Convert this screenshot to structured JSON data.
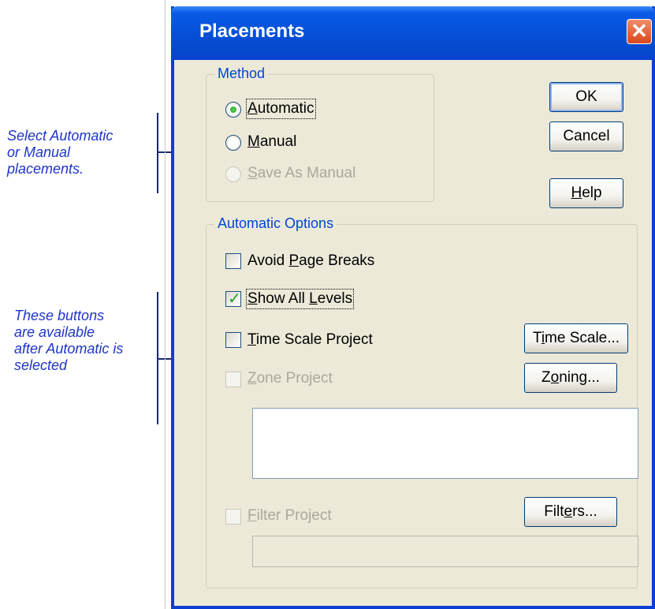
{
  "annotations": {
    "method_note": [
      "Select Automatic",
      "or Manual",
      "placements."
    ],
    "buttons_note": [
      "These buttons",
      "are available",
      "after Automatic is",
      "selected"
    ]
  },
  "dialog": {
    "title": "Placements",
    "close_icon": "close-icon",
    "method": {
      "legend": "Method",
      "options": [
        {
          "label": "Automatic",
          "selected": true,
          "enabled": true
        },
        {
          "label": "Manual",
          "selected": false,
          "enabled": true
        },
        {
          "label": "Save As Manual",
          "selected": false,
          "enabled": false
        }
      ]
    },
    "buttons": {
      "ok": "OK",
      "cancel": "Cancel",
      "help": "Help",
      "time_scale": "Time Scale...",
      "zoning": "Zoning...",
      "filters": "Filters..."
    },
    "automatic_options": {
      "legend": "Automatic Options",
      "avoid_page_breaks": {
        "label": "Avoid Page Breaks",
        "checked": false,
        "enabled": true
      },
      "show_all_levels": {
        "label": "Show All Levels",
        "checked": true,
        "enabled": true
      },
      "time_scale_project": {
        "label": "Time Scale Project",
        "checked": false,
        "enabled": true
      },
      "zone_project": {
        "label": "Zone Project",
        "checked": false,
        "enabled": false
      },
      "filter_project": {
        "label": "Filter Project",
        "checked": false,
        "enabled": false
      }
    }
  }
}
